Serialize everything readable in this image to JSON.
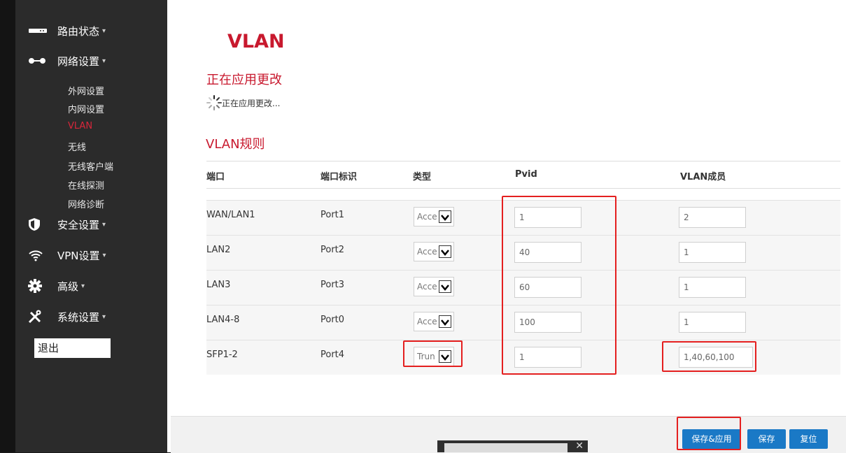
{
  "sidebar": {
    "main_items": [
      {
        "label": "路由状态",
        "icon": "router-icon"
      },
      {
        "label": "网络设置",
        "icon": "network-icon"
      },
      {
        "label": "安全设置",
        "icon": "shield-icon"
      },
      {
        "label": "VPN设置",
        "icon": "wifi-icon"
      },
      {
        "label": "高级",
        "icon": "gear-icon"
      },
      {
        "label": "系统设置",
        "icon": "tools-icon"
      }
    ],
    "caret": "▾",
    "sub_items": [
      "外网设置",
      "内网设置",
      "VLAN",
      "无线",
      "无线客户端",
      "在线探测",
      "网络诊断"
    ],
    "active_sub": "VLAN",
    "logout": "退出"
  },
  "main": {
    "title": "VLAN",
    "applying_title": "正在应用更改",
    "applying_status": "正在应用更改...",
    "rules_title": "VLAN规则",
    "columns": [
      "端口",
      "端口标识",
      "类型",
      "Pvid",
      "VLAN成员"
    ],
    "rows": [
      {
        "port": "WAN/LAN1",
        "id": "Port1",
        "type": "Acce",
        "pvid": "1",
        "member": "2"
      },
      {
        "port": "LAN2",
        "id": "Port2",
        "type": "Acce",
        "pvid": "40",
        "member": "1"
      },
      {
        "port": "LAN3",
        "id": "Port3",
        "type": "Acce",
        "pvid": "60",
        "member": "1"
      },
      {
        "port": "LAN4-8",
        "id": "Port0",
        "type": "Acce",
        "pvid": "100",
        "member": "1"
      },
      {
        "port": "SFP1-2",
        "id": "Port4",
        "type": "Trun",
        "pvid": "1",
        "member": "1,40,60,100"
      }
    ]
  },
  "footer": {
    "save_apply": "保存&应用",
    "save": "保存",
    "reset": "复位"
  },
  "popup": {
    "close": "✕"
  },
  "colors": {
    "accent": "#c8192e",
    "button": "#1a79c6",
    "highlight": "#e41f1f",
    "sidebar": "#2b2b2b"
  }
}
